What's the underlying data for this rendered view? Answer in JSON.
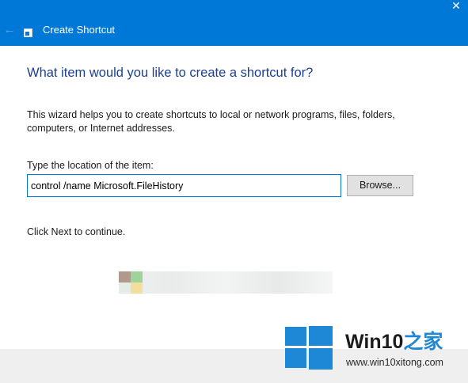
{
  "window": {
    "title": "Create Shortcut",
    "back_icon": "arrow-left-icon",
    "close_icon": "close-icon",
    "app_icon": "shortcut-icon",
    "accent_color": "#0078d7"
  },
  "content": {
    "heading": "What item would you like to create a shortcut for?",
    "description": "This wizard helps you to create shortcuts to local or network programs, files, folders, computers, or Internet addresses.",
    "location_label": "Type the location of the item:",
    "location_value": "control /name Microsoft.FileHistory",
    "browse_label": "Browse...",
    "continue_text": "Click Next to continue."
  },
  "watermark": {
    "brand_win": "Win10",
    "brand_suffix": "之家",
    "url": "www.win10xitong.com",
    "logo_icon": "windows-logo-icon",
    "brand_color": "#1e88d6"
  }
}
